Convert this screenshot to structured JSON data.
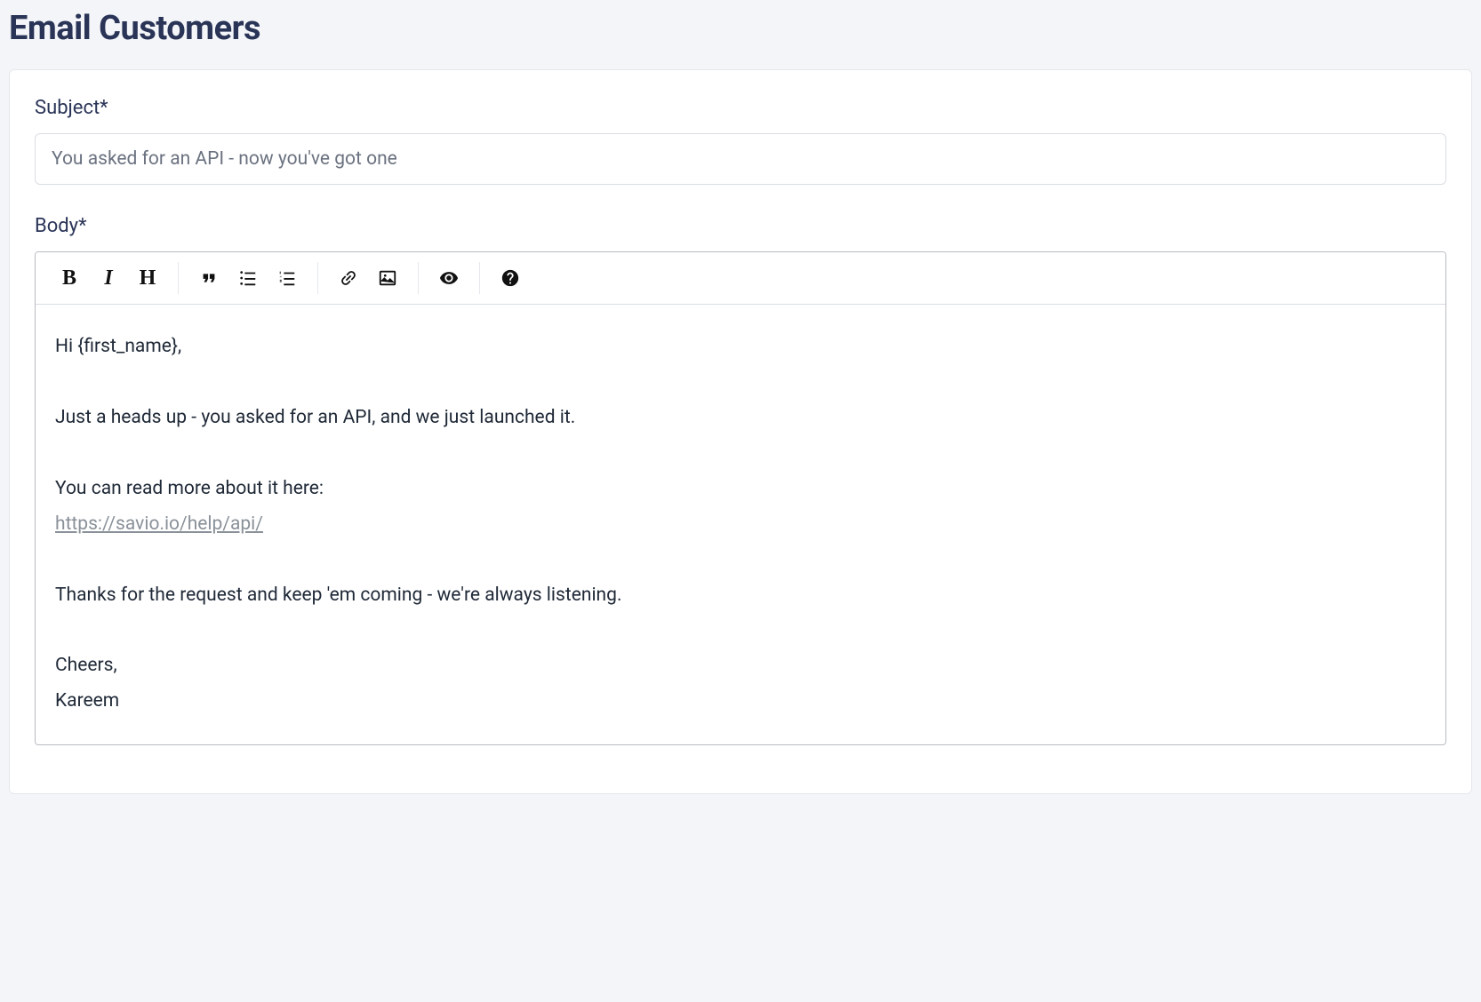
{
  "page": {
    "title": "Email Customers"
  },
  "form": {
    "subject": {
      "label": "Subject*",
      "value": "You asked for an API - now you've got one"
    },
    "body": {
      "label": "Body*",
      "content": {
        "greeting": "Hi {first_name},",
        "line1": "Just a heads up - you asked for an API, and we just launched it.",
        "line2": "You can read more about it here:",
        "link_text": "https://savio.io/help/api/",
        "line3": "Thanks for the request and keep 'em coming - we're always listening.",
        "closing1": "Cheers,",
        "closing2": "Kareem"
      }
    }
  },
  "toolbar": {
    "bold": "B",
    "italic": "I",
    "heading": "H"
  }
}
